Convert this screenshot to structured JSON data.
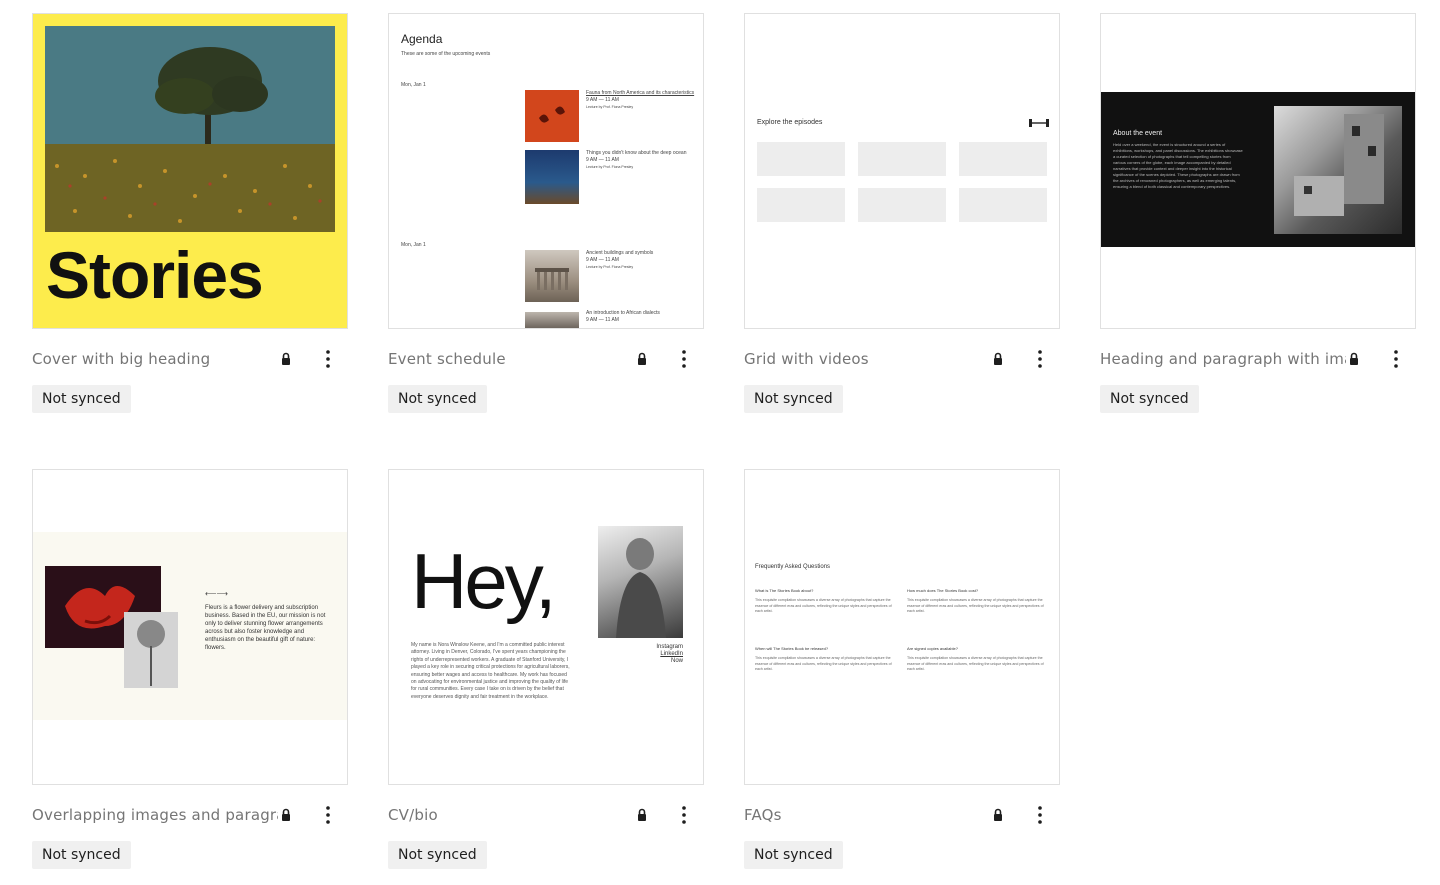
{
  "patterns": [
    {
      "title": "Cover with big heading",
      "badge": "Not synced"
    },
    {
      "title": "Event schedule",
      "badge": "Not synced"
    },
    {
      "title": "Grid with videos",
      "badge": "Not synced"
    },
    {
      "title": "Heading and paragraph with image",
      "badge": "Not synced"
    },
    {
      "title": "Overlapping images and paragraph",
      "badge": "Not synced"
    },
    {
      "title": "CV/bio",
      "badge": "Not synced"
    },
    {
      "title": "FAQs",
      "badge": "Not synced"
    }
  ],
  "previews": {
    "cover": {
      "heading": "Stories"
    },
    "agenda": {
      "title": "Agenda",
      "subtitle": "These are some of the upcoming events",
      "dates": [
        "Mon, Jan 1",
        "Mon, Jan 1"
      ],
      "events": [
        {
          "name": "Fauna from North America and its characteristics",
          "time": "9 AM — 11 AM",
          "host": "Lecture by Prof. Fiona Presley"
        },
        {
          "name": "Things you didn't know about the deep ocean",
          "time": "9 AM — 11 AM",
          "host": "Lecture by Prof. Fiona Presley"
        },
        {
          "name": "Ancient buildings and symbols",
          "time": "9 AM — 11 AM",
          "host": "Lecture by Prof. Fiona Presley"
        },
        {
          "name": "An introduction to African dialects",
          "time": "9 AM — 11 AM",
          "host": ""
        }
      ]
    },
    "grid_videos": {
      "title": "Explore the episodes"
    },
    "about": {
      "title": "About the event",
      "text": "Held over a weekend, the event is structured around a series of exhibitions, workshops, and panel discussions. The exhibitions showcase a curated selection of photographs that tell compelling stories from various corners of the globe, each image accompanied by detailed narratives that provide context and deeper insight into the historical significance of the scenes depicted. These photographs are drawn from the archives of renowned photographers, as well as emerging talents, ensuring a blend of both classical and contemporary perspectives."
    },
    "overlap": {
      "control": "⟵⟶",
      "text": "Fleurs is a flower delivery and subscription business. Based in the EU, our mission is not only to deliver stunning flower arrangements across but also foster knowledge and enthusiasm on the beautiful gift of nature: flowers."
    },
    "cv": {
      "heading": "Hey,",
      "bio": "My name is Nora Winslow Keene, and I'm a committed public interest attorney. Living in Denver, Colorado, I've spent years championing the rights of underrepresented workers. A graduate of Stanford University, I played a key role in securing critical protections for agricultural laborers, ensuring better wages and access to healthcare. My work has focused on advocating for environmental justice and improving the quality of life for rural communities. Every case I take on is driven by the belief that everyone deserves dignity and fair treatment in the workplace.",
      "links": [
        "Instagram",
        "LinkedIn",
        "Now"
      ]
    },
    "faq": {
      "title": "Frequently Asked Questions",
      "items": [
        {
          "q": "What is The Stories Book about?",
          "a": "This exquisite compilation showcases a diverse array of photographs that capture the essence of different eras and cultures, reflecting the unique styles and perspectives of each artist."
        },
        {
          "q": "How much does The Stories Book cost?",
          "a": "This exquisite compilation showcases a diverse array of photographs that capture the essence of different eras and cultures, reflecting the unique styles and perspectives of each artist."
        },
        {
          "q": "When will The Stories Book be released?",
          "a": "This exquisite compilation showcases a diverse array of photographs that capture the essence of different eras and cultures, reflecting the unique styles and perspectives of each artist."
        },
        {
          "q": "Are signed copies available?",
          "a": "This exquisite compilation showcases a diverse array of photographs that capture the essence of different eras and cultures, reflecting the unique styles and perspectives of each artist."
        }
      ]
    }
  },
  "icons": {
    "lock": "lock-icon",
    "more": "more-vertical-icon"
  },
  "colors": {
    "cover_bg": "#fdec4c",
    "badge_bg": "#f0f0f0",
    "title_text": "#757575",
    "about_band": "#111111",
    "overlap_band": "#faf9f1"
  }
}
